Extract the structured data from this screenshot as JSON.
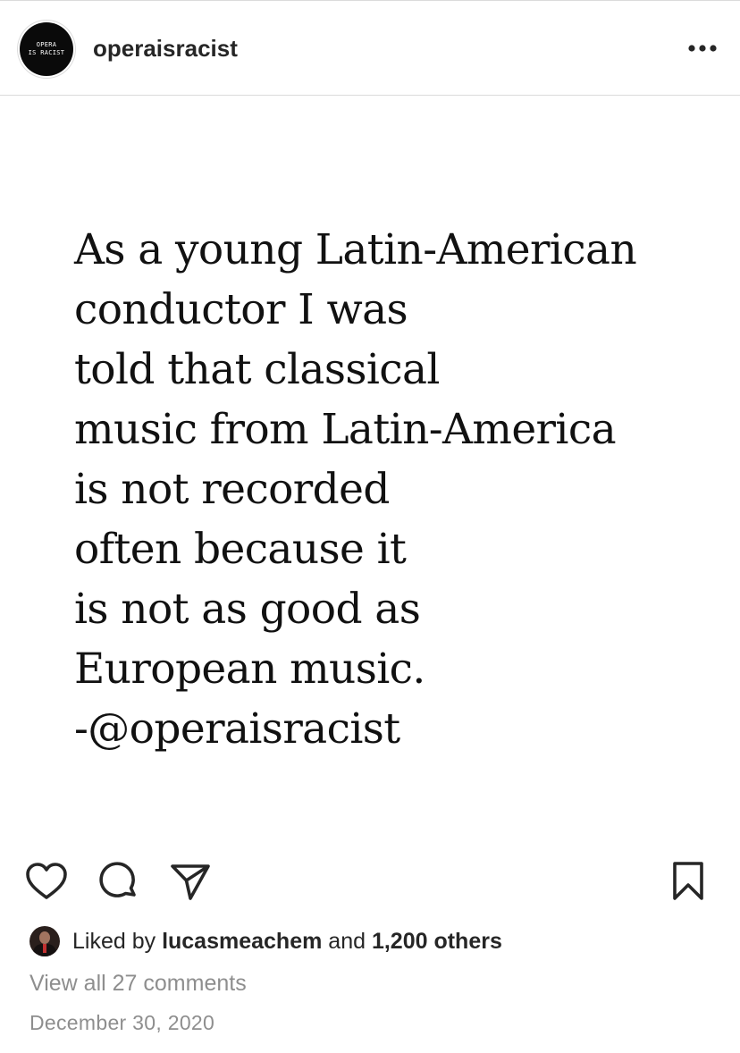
{
  "header": {
    "avatar_text": [
      "OPERA",
      "IS RACIST"
    ],
    "username": "operaisracist",
    "more_icon": "more-horizontal-icon"
  },
  "post": {
    "lines": [
      "As a young Latin-American",
      "conductor I was",
      "told that classical",
      "music from Latin-America",
      "is not recorded",
      "often because it",
      "is not as good as",
      "European music.",
      "-@operaisracist"
    ]
  },
  "actions": {
    "like_icon": "heart-icon",
    "comment_icon": "comment-icon",
    "share_icon": "send-icon",
    "save_icon": "bookmark-icon"
  },
  "likes": {
    "prefix": "Liked by ",
    "user": "lucasmeachem",
    "middle": " and ",
    "others": "1,200 others"
  },
  "comments": {
    "label": "View all 27 comments"
  },
  "date": "December 30, 2020",
  "colors": {
    "text": "#262626",
    "secondary": "#8e8e8e",
    "divider": "#dbdbdb"
  }
}
